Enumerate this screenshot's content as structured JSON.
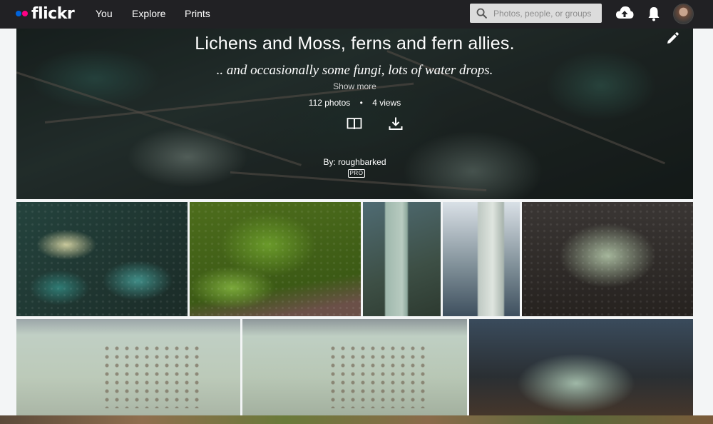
{
  "nav": {
    "logo_text": "flickr",
    "links": [
      "You",
      "Explore",
      "Prints"
    ],
    "search_placeholder": "Photos, people, or groups"
  },
  "album": {
    "title": "Lichens and Moss, ferns and fern allies.",
    "description": ".. and occasionally some fungi, lots of water drops.",
    "show_more": "Show more",
    "photo_count": "112 photos",
    "separator": "•",
    "views": "4 views",
    "owner": "By: roughbarked",
    "badge": "PRO"
  },
  "colors": {
    "nav_bg": "#212124",
    "logo_blue": "#0063dc",
    "logo_pink": "#ff0084"
  }
}
